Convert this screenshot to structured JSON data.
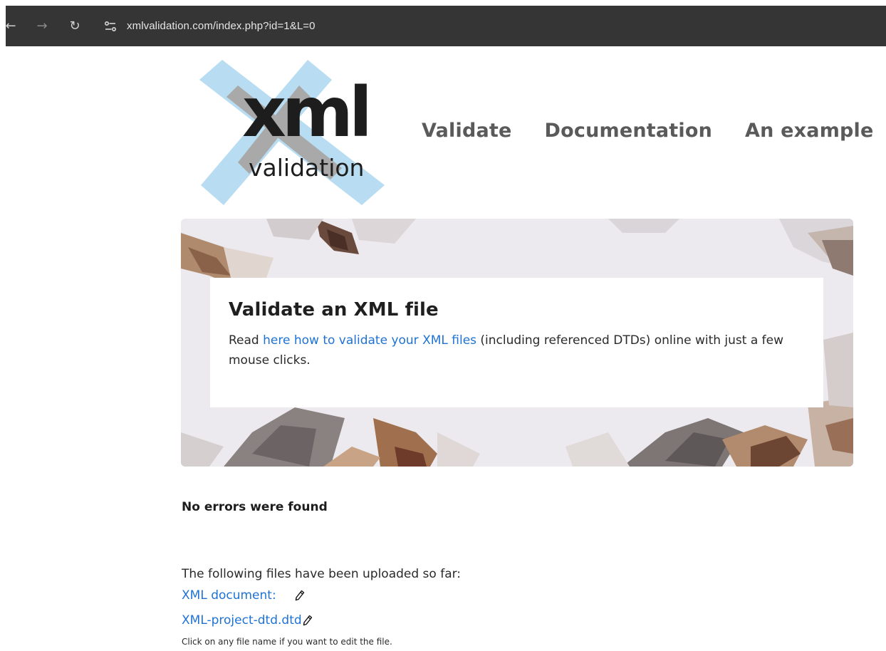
{
  "browser": {
    "back_icon": "arrow-left-icon",
    "forward_icon": "arrow-right-icon",
    "reload_icon": "reload-icon",
    "site_info_icon": "site-settings-icon",
    "url": "xmlvalidation.com/index.php?id=1&L=0"
  },
  "logo": {
    "word": "xml",
    "subword": "validation"
  },
  "nav": {
    "validate": "Validate",
    "documentation": "Documentation",
    "example": "An example"
  },
  "hero": {
    "title": "Validate an XML file",
    "text_before": "Read ",
    "link": "here how to validate your XML files",
    "text_after": " (including referenced DTDs) online with just a few mouse clicks."
  },
  "status": "No errors were found",
  "files": {
    "label": "The following files have been uploaded so far:",
    "items": [
      {
        "name": "XML document:",
        "edit_icon": "pencil-icon"
      },
      {
        "name": "XML-project-dtd.dtd",
        "edit_icon": "pencil-icon"
      }
    ],
    "hint": "Click on any file name if you want to edit the file."
  },
  "colors": {
    "link": "#1e72d6",
    "nav": "#5a5a5a",
    "browser_bar": "#353535",
    "logo_x": "#b8dcf1"
  }
}
